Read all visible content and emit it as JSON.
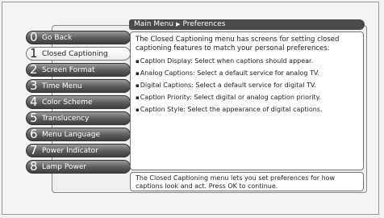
{
  "breadcrumb": {
    "root": "Main Menu",
    "arrow": "▶",
    "current": "Preferences"
  },
  "menu": {
    "items": [
      {
        "num": "0",
        "label": "Go Back",
        "selected": false
      },
      {
        "num": "1",
        "label": "Closed Captioning",
        "selected": true
      },
      {
        "num": "2",
        "label": "Screen Format",
        "selected": false
      },
      {
        "num": "3",
        "label": "Time Menu",
        "selected": false
      },
      {
        "num": "4",
        "label": "Color Scheme",
        "selected": false
      },
      {
        "num": "5",
        "label": "Translucency",
        "selected": false
      },
      {
        "num": "6",
        "label": "Menu Language",
        "selected": false
      },
      {
        "num": "7",
        "label": "Power Indicator",
        "selected": false
      },
      {
        "num": "8",
        "label": "Lamp Power",
        "selected": false
      }
    ]
  },
  "content": {
    "intro": "The Closed Captioning menu has screens for setting closed captioning features to match your personal preferences:",
    "bullet_glyph": "▪",
    "bullets": [
      "Caption Display: Select when captions should appear.",
      "Analog Captions: Select a default service for analog TV.",
      "Digital Captions: Select a default service for digital TV.",
      "Caption Priority: Select digital or analog caption priority.",
      "Caption Style: Select the appearance of digital captions."
    ]
  },
  "help": {
    "text": "The Closed Captioning menu lets you set preferences for how captions look and act. Press OK to continue."
  }
}
